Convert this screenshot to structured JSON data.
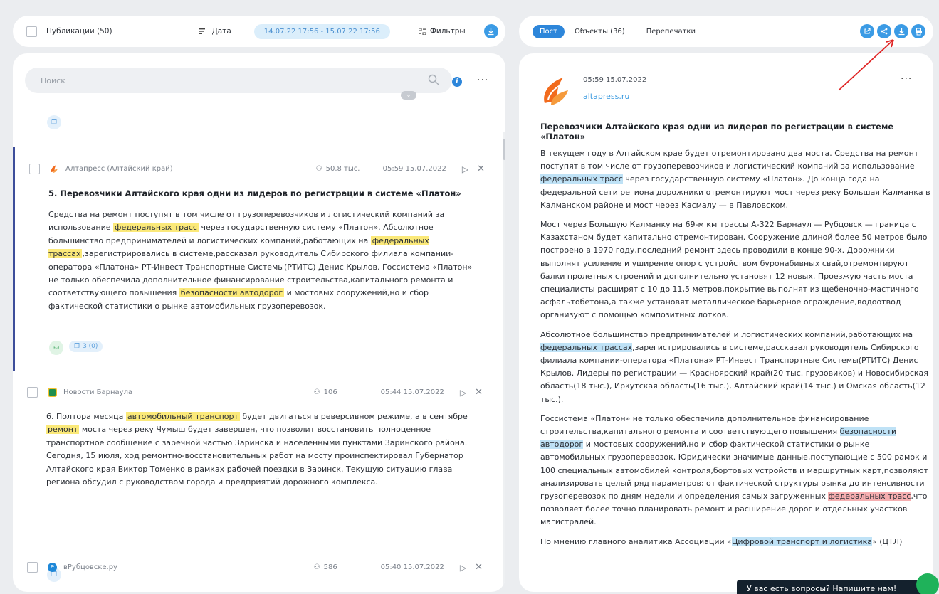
{
  "toolbar": {
    "publications_label": "Публикации (50)",
    "sort_label": "Дата",
    "date_range": "14.07.22 17:56 - 15.07.22 17:56",
    "filters_label": "Фильтры"
  },
  "post_tabs": {
    "post": "Пост",
    "objects": "Объекты (36)",
    "reprints": "Перепечатки"
  },
  "search": {
    "placeholder": "Поиск"
  },
  "items": [
    {
      "source": "Алтапресс (Алтайский край)",
      "reach": "50.8 тыс.",
      "datetime": "05:59 15.07.2022",
      "title": "5. Перевозчики Алтайского края одни из лидеров по регистрации в системе «Платон»",
      "text_parts": [
        "Средства на ремонт поступят в том числе от грузоперевозчиков и логистический компаний за использование ",
        "федеральных трасс",
        " через государственную систему «Платон». Абсолютное большинство предпринимателей и логистических компаний,работающих на ",
        "федеральных трассах",
        ",зарегистрировались в системе,рассказал руководитель Сибирского филиала компании-оператора «Платона» РТ-Инвест Транспортные Системы(РТИТС) Денис Крылов. Госсистема «Платон» не только обеспечила дополнительное финансирование строительства,капитального ремонта и соответствующего повышения ",
        "безопасности автодорог",
        " и мостовых сооружений,но и сбор фактической статистики о рынке автомобильных грузоперевозок."
      ],
      "copies": "3 (0)",
      "logo_color": "#f26b1d"
    },
    {
      "source": "Новости Барнаула",
      "reach": "106",
      "datetime": "05:44 15.07.2022",
      "text_parts": [
        "6. Полтора месяца ",
        "автомобильный транспорт",
        " будет двигаться в реверсивном режиме, а в сентябре ",
        "ремонт",
        " моста через реку Чумыш будет завершен, что позволит восстановить полноценное транспортное сообщение с заречной частью Заринска и населенными пунктами Заринского района. Сегодня, 15 июля, ход ремонтно-восстановительных работ на мосту проинспектировал Губернатор Алтайского края Виктор Томенко в рамках рабочей поездки в Заринск. Текущую ситуацию глава региона обсудил с руководством города и предприятий дорожного комплекса."
      ],
      "logo_color": "#1e8f4e"
    },
    {
      "source": "вРубцовске.ру",
      "reach": "586",
      "datetime": "05:40 15.07.2022",
      "logo_color": "#1f88d8"
    }
  ],
  "post": {
    "datetime": "05:59 15.07.2022",
    "source_link": "altapress.ru",
    "title": "Перевозчики Алтайского края одни из лидеров по регистрации в системе «Платон»",
    "p1": [
      "В текущем году в Алтайском крае будет отремонтировано два моста. Средства на ремонт поступят в том числе от грузоперевозчиков и логистический компаний за использование ",
      "федеральных трасс",
      " через государственную систему «Платон». До конца года на федеральной сети региона дорожники отремонтируют мост через реку Большая Калманка в Калманском районе и мост через Касмалу — в Павловском."
    ],
    "p2": "Мост через Большую Калманку на 69-м км трассы А-322 Барнаул — Рубцовск — граница с Казахстаном будет капитально отремонтирован. Сооружение длиной более 50 метров было построено в 1970 году,последний ремонт здесь проводили в конце 90-х. Дорожники выполнят усиление и уширение опор с устройством буронабивных свай,отремонтируют балки пролетных строений и дополнительно установят 12 новых. Проезжую часть моста специалисты расширят с 10 до 11,5 метров,покрытие выполнят из щебеночно-мастичного асфальтобетона,а также установят металлическое барьерное ограждение,водоотвод организуют с помощью композитных лотков.",
    "p3": [
      "Абсолютное большинство предпринимателей и логистических компаний,работающих на ",
      "федеральных трассах",
      ",зарегистрировались в системе,рассказал руководитель Сибирского филиала компании-оператора «Платона» РТ-Инвест Транспортные Системы(РТИТС) Денис Крылов. Лидеры по регистрации — Красноярский край(20 тыс. грузовиков) и Новосибирская область(18 тыс.), Иркутская область(16 тыс.), Алтайский край(14 тыс.) и Омская область(12 тыс.)."
    ],
    "p4": [
      "Госсистема «Платон» не только обеспечила дополнительное финансирование строительства,капитального ремонта и соответствующего повышения ",
      "безопасности автодорог",
      " и мостовых сооружений,но и сбор фактической статистики о рынке автомобильных грузоперевозок. Юридически значимые данные,поступающие с 500 рамок и 100 специальных автомобилей контроля,бортовых устройств и маршрутных карт,позволяют анализировать целый ряд параметров: от фактической структуры рынка до интенсивности грузоперевозок по дням недели и определения самых загруженных ",
      "федеральных трасс",
      ",что позволяет более точно планировать ремонт и расширение дорог и отдельных участков магистралей."
    ],
    "p5": [
      "По мнению главного аналитика Ассоциации «",
      "Цифровой транспорт и логистика",
      "» (ЦТЛ)"
    ]
  },
  "chat": {
    "label": "У вас есть вопросы? Напишите нам!"
  },
  "colors": {
    "accent": "#2d86da",
    "highlight_yellow": "#fbe979",
    "highlight_blue": "#bfe2f6",
    "highlight_red": "#f6aeb0"
  }
}
